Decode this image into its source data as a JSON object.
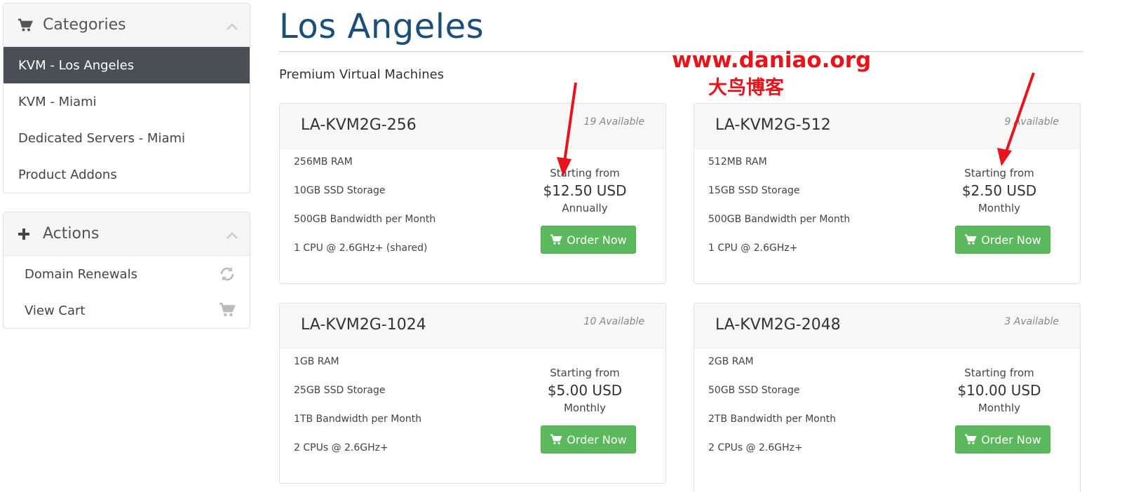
{
  "sidebar": {
    "categories": {
      "title": "Categories",
      "items": [
        {
          "label": "KVM - Los Angeles",
          "active": true
        },
        {
          "label": "KVM - Miami"
        },
        {
          "label": "Dedicated Servers - Miami"
        },
        {
          "label": "Product Addons"
        }
      ]
    },
    "actions": {
      "title": "Actions",
      "items": [
        {
          "label": "Domain Renewals",
          "icon": "refresh-icon"
        },
        {
          "label": "View Cart",
          "icon": "cart-icon"
        }
      ]
    }
  },
  "main": {
    "title": "Los Angeles",
    "subtitle": "Premium Virtual Machines",
    "products": [
      {
        "name": "LA-KVM2G-256",
        "available": "19 Available",
        "features": [
          "256MB RAM",
          "10GB SSD Storage",
          "500GB Bandwidth per Month",
          "1 CPU @ 2.6GHz+ (shared)"
        ],
        "starting_from": "Starting from",
        "price": "$12.50 USD",
        "cycle": "Annually",
        "order_label": "Order Now"
      },
      {
        "name": "LA-KVM2G-512",
        "available": "9 Available",
        "features": [
          "512MB RAM",
          "15GB SSD Storage",
          "500GB Bandwidth per Month",
          "1 CPU @ 2.6GHz+"
        ],
        "starting_from": "Starting from",
        "price": "$2.50 USD",
        "cycle": "Monthly",
        "order_label": "Order Now"
      },
      {
        "name": "LA-KVM2G-1024",
        "available": "10 Available",
        "features": [
          "1GB RAM",
          "25GB SSD Storage",
          "1TB Bandwidth per Month",
          "2 CPUs @ 2.6GHz+"
        ],
        "starting_from": "Starting from",
        "price": "$5.00 USD",
        "cycle": "Monthly",
        "order_label": "Order Now"
      },
      {
        "name": "LA-KVM2G-2048",
        "available": "3 Available",
        "features": [
          "2GB RAM",
          "50GB SSD Storage",
          "2TB Bandwidth per Month",
          "2 CPUs @ 2.6GHz+"
        ],
        "starting_from": "Starting from",
        "price": "$10.00 USD",
        "cycle": "Monthly",
        "order_label": "Order Now"
      }
    ]
  },
  "watermark": {
    "url": "www.daniao.org",
    "name": "大鸟博客"
  },
  "colors": {
    "active_category_bg": "#4a4f55",
    "title_blue": "#1a4f7a",
    "order_green": "#5cb85c",
    "annotation_red": "#e8141b"
  }
}
